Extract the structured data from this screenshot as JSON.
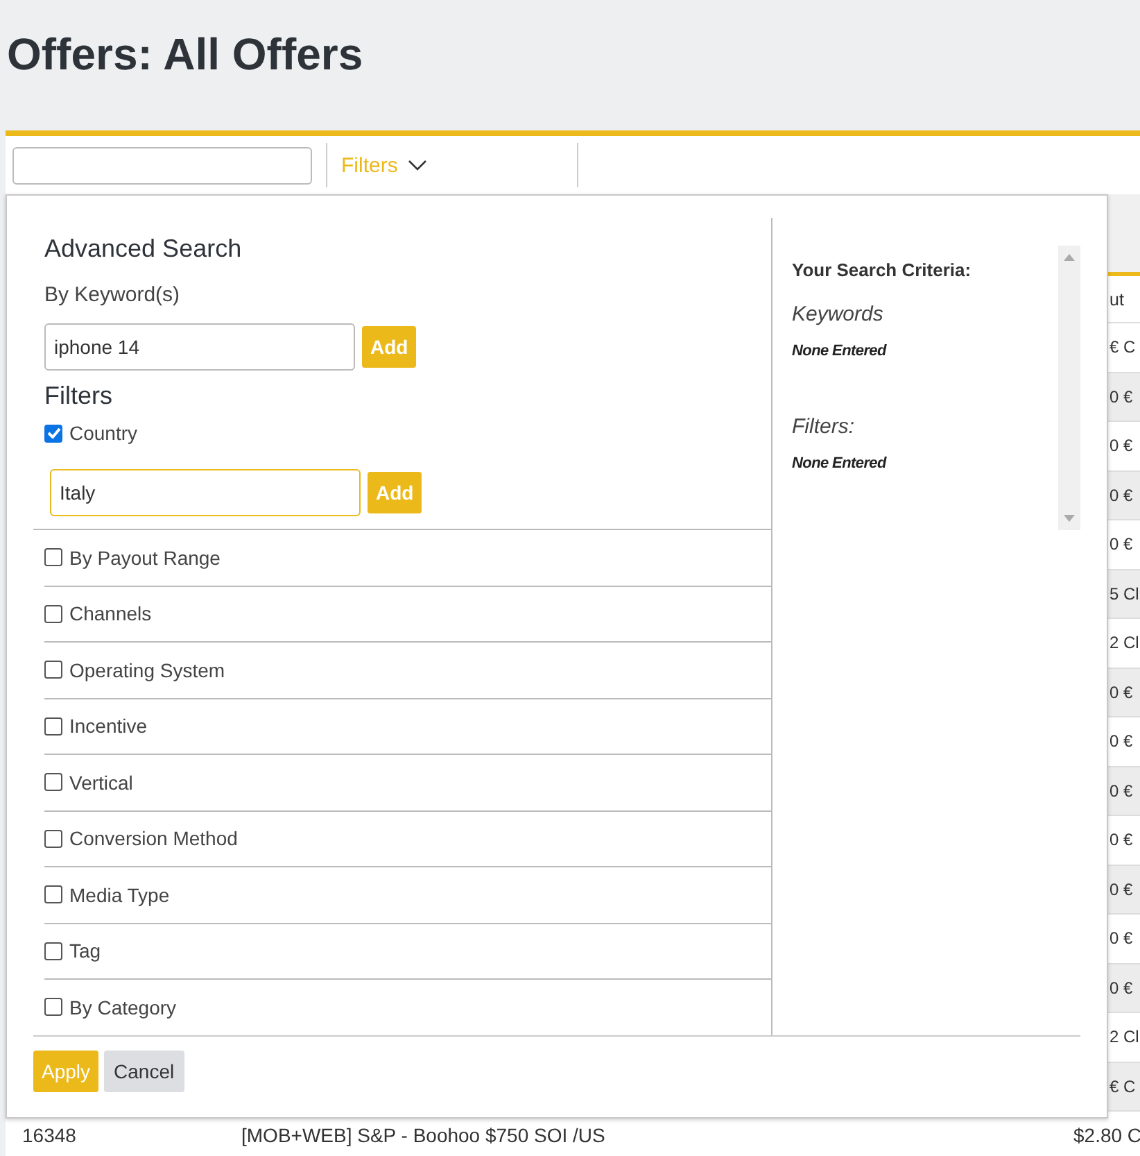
{
  "page": {
    "title": "Offers: All Offers"
  },
  "toolbar": {
    "filters_label": "Filters"
  },
  "table": {
    "column_3_header": "ut",
    "rows": [
      {
        "column_3": "€ C"
      },
      {
        "column_3": "0 €"
      },
      {
        "column_3": "0 €"
      },
      {
        "column_3": "0 €"
      },
      {
        "column_3": "0 €"
      },
      {
        "column_3": "5 Cl"
      },
      {
        "column_3": "2 Cl"
      },
      {
        "column_3": "0 €"
      },
      {
        "column_3": "0 €"
      },
      {
        "column_3": "0 €"
      },
      {
        "column_3": "0 €"
      },
      {
        "column_3": "0 €"
      },
      {
        "column_3": "0 €"
      },
      {
        "column_3": "0 €"
      },
      {
        "column_3": "2 Cl"
      },
      {
        "column_3": "€ C"
      },
      {
        "column_1": "16348",
        "column_2": "[MOB+WEB] S&P - Boohoo $750 SOI /US",
        "column_3": "$2.80 C"
      }
    ]
  },
  "advanced_search": {
    "title": "Advanced Search",
    "keyword_label": "By Keyword(s)",
    "keyword_value": "iphone 14",
    "keyword_add": "Add",
    "filters_title": "Filters",
    "filters": [
      {
        "label": "Country",
        "checked": true,
        "value": "Italy",
        "add": "Add"
      },
      {
        "label": "By Payout Range",
        "checked": false
      },
      {
        "label": "Channels",
        "checked": false
      },
      {
        "label": "Operating System",
        "checked": false
      },
      {
        "label": "Incentive",
        "checked": false
      },
      {
        "label": "Vertical",
        "checked": false
      },
      {
        "label": "Conversion Method",
        "checked": false
      },
      {
        "label": "Media Type",
        "checked": false
      },
      {
        "label": "Tag",
        "checked": false
      },
      {
        "label": "By Category",
        "checked": false
      }
    ],
    "criteria": {
      "title": "Your Search Criteria:",
      "keywords_heading": "Keywords",
      "keywords_value": "None Entered",
      "filters_heading": "Filters:",
      "filters_value": "None Entered"
    },
    "buttons": {
      "apply": "Apply",
      "cancel": "Cancel"
    }
  }
}
